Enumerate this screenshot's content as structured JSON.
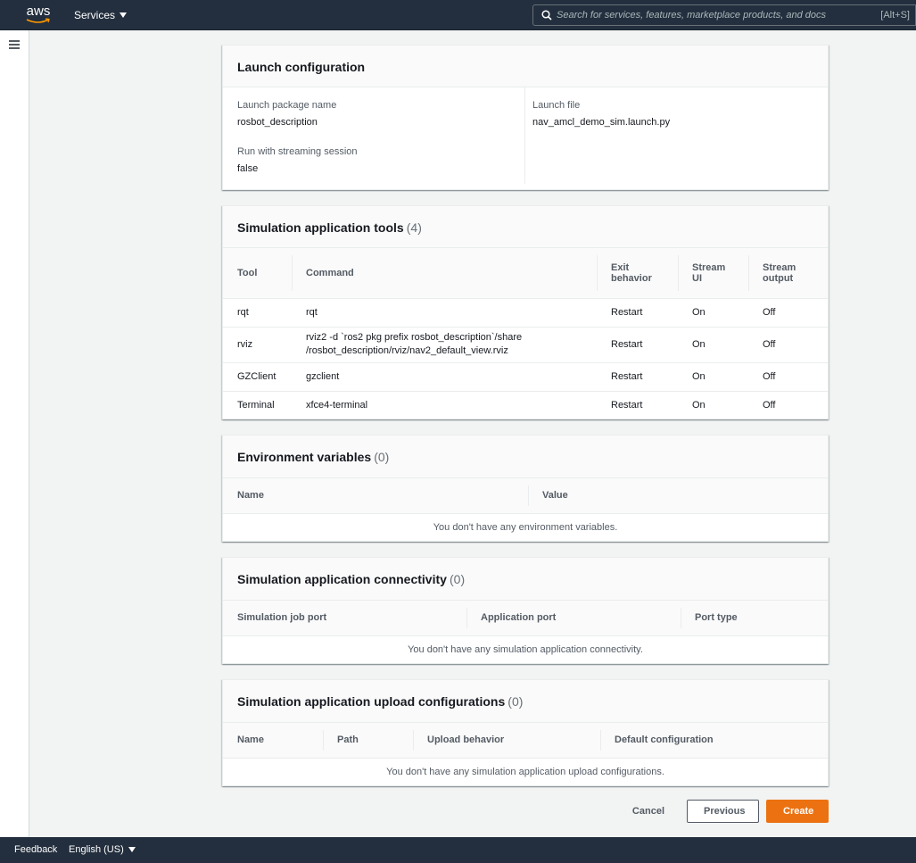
{
  "nav": {
    "logo_text": "aws",
    "services_label": "Services",
    "search_placeholder": "Search for services, features, marketplace products, and docs",
    "search_shortcut": "[Alt+S]"
  },
  "launch_config": {
    "title": "Launch configuration",
    "package_label": "Launch package name",
    "package_value": "rosbot_description",
    "streaming_label": "Run with streaming session",
    "streaming_value": "false",
    "file_label": "Launch file",
    "file_value": "nav_amcl_demo_sim.launch.py"
  },
  "tools": {
    "title": "Simulation application tools",
    "count": "(4)",
    "headers": [
      "Tool",
      "Command",
      "Exit behavior",
      "Stream UI",
      "Stream output"
    ],
    "rows": [
      {
        "tool": "rqt",
        "command": "rqt",
        "exit": "Restart",
        "ui": "On",
        "output": "Off"
      },
      {
        "tool": "rviz",
        "command": "rviz2 -d `ros2 pkg prefix rosbot_description`/share /rosbot_description/rviz/nav2_default_view.rviz",
        "exit": "Restart",
        "ui": "On",
        "output": "Off"
      },
      {
        "tool": "GZClient",
        "command": "gzclient",
        "exit": "Restart",
        "ui": "On",
        "output": "Off"
      },
      {
        "tool": "Terminal",
        "command": "xfce4-terminal",
        "exit": "Restart",
        "ui": "On",
        "output": "Off"
      }
    ]
  },
  "env": {
    "title": "Environment variables",
    "count": "(0)",
    "headers": [
      "Name",
      "Value"
    ],
    "empty": "You don't have any environment variables."
  },
  "connectivity": {
    "title": "Simulation application connectivity",
    "count": "(0)",
    "headers": [
      "Simulation job port",
      "Application port",
      "Port type"
    ],
    "empty": "You don't have any simulation application connectivity."
  },
  "upload": {
    "title": "Simulation application upload configurations",
    "count": "(0)",
    "headers": [
      "Name",
      "Path",
      "Upload behavior",
      "Default configuration"
    ],
    "empty": "You don't have any simulation application upload configurations."
  },
  "actions": {
    "cancel": "Cancel",
    "previous": "Previous",
    "create": "Create"
  },
  "footer": {
    "feedback": "Feedback",
    "language": "English (US)"
  }
}
